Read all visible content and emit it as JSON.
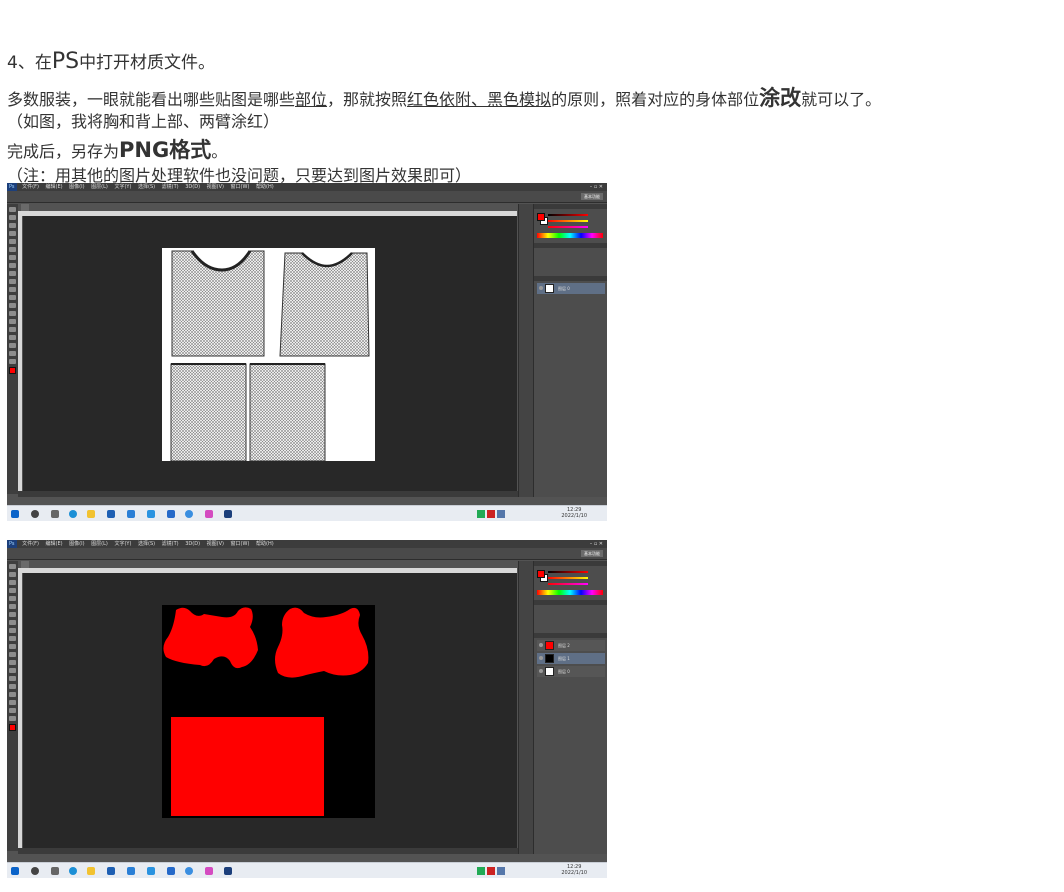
{
  "article": {
    "step_prefix": "4、在",
    "step_ps": "PS",
    "step_suffix": "中打开材质文件。",
    "p2_a": "多数服装，一眼就能看出哪些贴图是哪些",
    "p2_u1": "部位",
    "p2_b": "，那就按照",
    "p2_u2": "红色依附、黑色模拟",
    "p2_c": "的原则，照着对应的身体部位",
    "p2_bold": "涂改",
    "p2_d": "就可以了。",
    "p3": "（如图，我将胸和背上部、两臂涂红）",
    "p4_a": "完成后，另存为",
    "p4_bold": "PNG格式",
    "p4_b": "。",
    "p5": "（注：用其他的图片处理软件也没问题，只要达到图片效果即可）"
  },
  "screenshot1": {
    "app_logo": "Ps",
    "menus": [
      "文件(F)",
      "编辑(E)",
      "图像(I)",
      "图层(L)",
      "文字(Y)",
      "选择(S)",
      "滤镜(T)",
      "3D(D)",
      "视图(V)",
      "窗口(W)",
      "帮助(H)"
    ],
    "workspace": "基本功能",
    "window_controls": "– ▫ ✕",
    "taskbar_time": "12:29",
    "taskbar_date": "2022/1/10",
    "layers": [
      {
        "name": "图层 0",
        "thumb": "white"
      }
    ],
    "fg_color": "#ff0000",
    "bg_color": "#ffffff"
  },
  "screenshot2": {
    "app_logo": "Ps",
    "menus": [
      "文件(F)",
      "编辑(E)",
      "图像(I)",
      "图层(L)",
      "文字(Y)",
      "选择(S)",
      "滤镜(T)",
      "3D(D)",
      "视图(V)",
      "窗口(W)",
      "帮助(H)"
    ],
    "workspace": "基本功能",
    "window_controls": "– ▫ ✕",
    "taskbar_time": "12:29",
    "taskbar_date": "2022/1/10",
    "layers": [
      {
        "name": "图层 2",
        "thumb": "red"
      },
      {
        "name": "图层 1",
        "thumb": "black"
      },
      {
        "name": "图层 0",
        "thumb": "white"
      }
    ],
    "fg_color": "#ff0000",
    "bg_color": "#ffffff"
  }
}
